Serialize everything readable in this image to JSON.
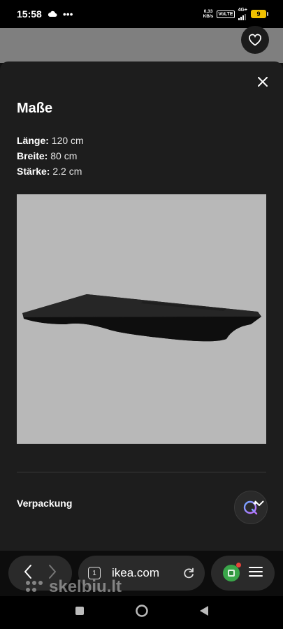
{
  "status_bar": {
    "time": "15:58",
    "net_speed_value": "0,33",
    "net_speed_unit": "KB/s",
    "volte": "VoLTE",
    "network": "4G+",
    "battery": "9"
  },
  "modal": {
    "title": "Maße",
    "specs": [
      {
        "key": "Länge:",
        "value": "120 cm"
      },
      {
        "key": "Breite:",
        "value": "80 cm"
      },
      {
        "key": "Stärke:",
        "value": "2.2 cm"
      }
    ],
    "accordion_label": "Verpackung"
  },
  "browser": {
    "tab_count": "1",
    "url": "ikea.com"
  },
  "watermark": "skelbiu.lt",
  "icons": {
    "heart": "heart-icon",
    "close": "close-icon",
    "ai": "ai-assistant-icon",
    "chevron": "chevron-down-icon",
    "back": "back-arrow-icon",
    "forward": "forward-arrow-icon",
    "reload": "reload-icon",
    "menu": "hamburger-menu-icon"
  }
}
